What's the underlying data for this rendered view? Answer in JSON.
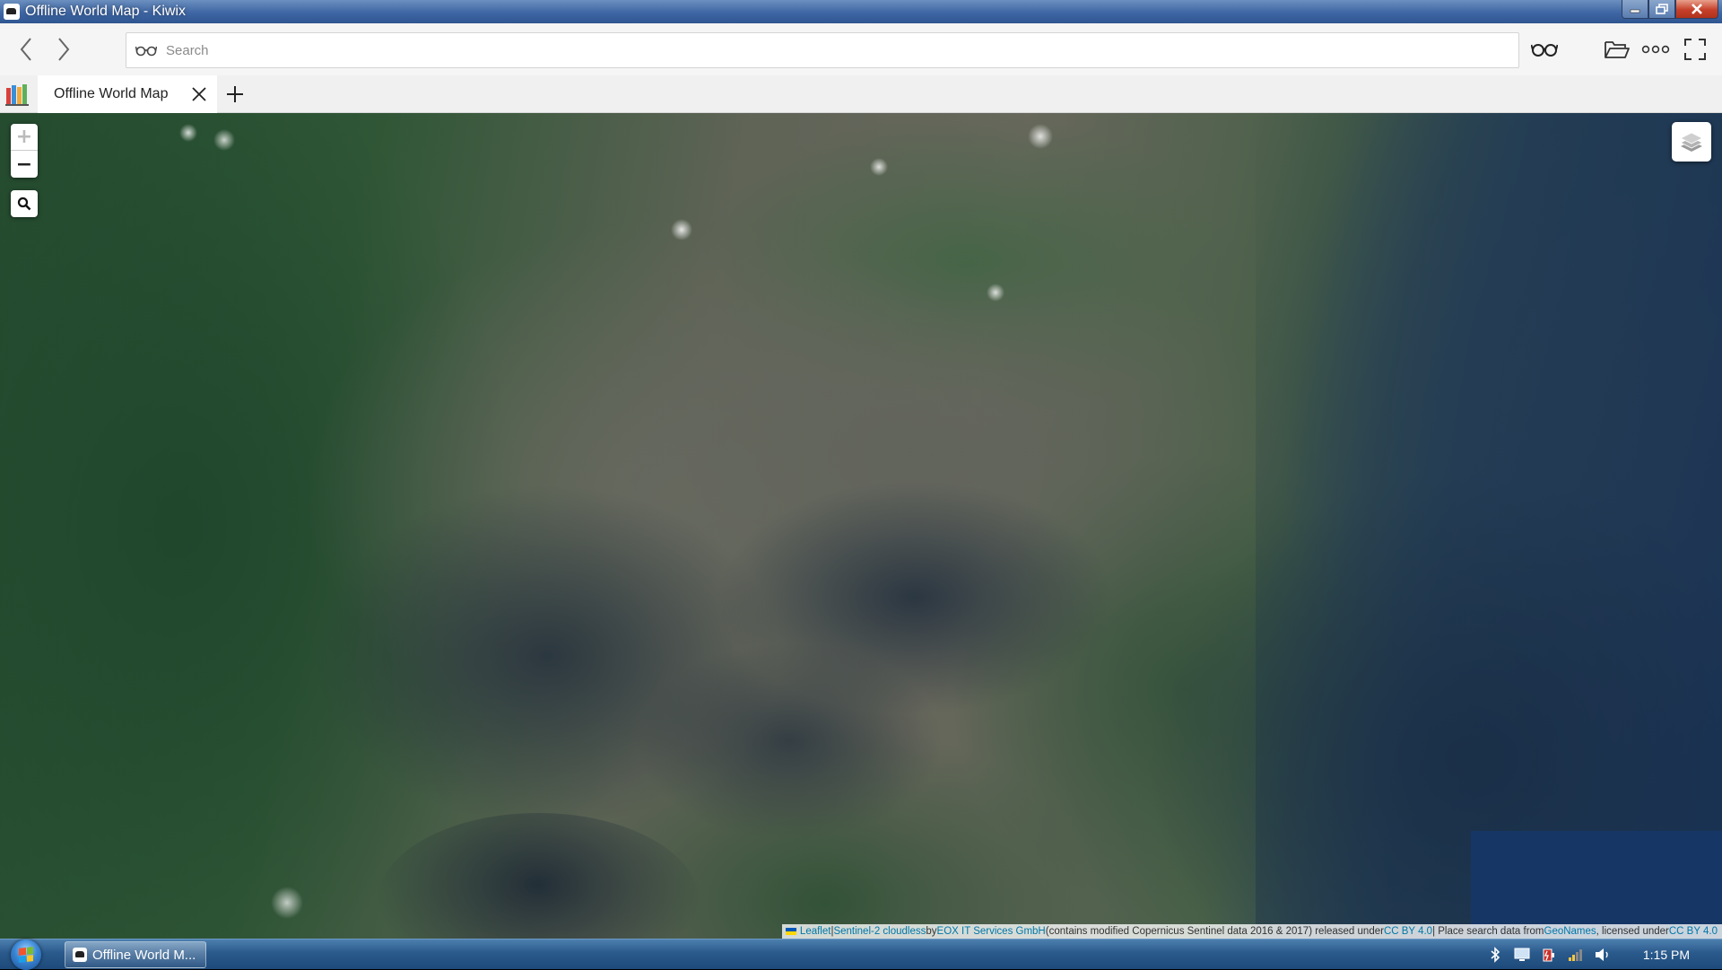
{
  "window": {
    "title": "Offline World Map - Kiwix",
    "controls": {
      "minimize": "minimize-icon",
      "maximize": "maximize-icon",
      "close": "close-icon"
    }
  },
  "toolbar": {
    "back_icon": "back-arrow-icon",
    "forward_icon": "forward-arrow-icon",
    "search_placeholder": "Search",
    "search_value": "",
    "reading_mode_icon": "glasses-icon",
    "open_file_icon": "folder-open-icon",
    "menu_icon": "more-dots-icon",
    "fullscreen_icon": "fullscreen-icon"
  },
  "tabs": {
    "library_icon": "library-books-icon",
    "items": [
      {
        "label": "Offline World Map",
        "active": true
      }
    ],
    "new_tab_icon": "plus-icon"
  },
  "map": {
    "zoom_in_label": "+",
    "zoom_out_label": "−",
    "zoom_in_disabled": true,
    "search_icon": "magnifier-icon",
    "layers_icon": "layers-icon",
    "attribution": {
      "leaflet": "Leaflet",
      "sep1": " | ",
      "sentinel": "Sentinel-2 cloudless",
      "by": " by ",
      "eox": "EOX IT Services GmbH",
      "contains": " (contains modified Copernicus Sentinel data 2016 & 2017) released under ",
      "ccby1": "CC BY 4.0",
      "sep2": " | Place search data from ",
      "geonames": "GeoNames",
      "licensed": ", licensed under ",
      "ccby2": "CC BY 4.0"
    }
  },
  "taskbar": {
    "start_icon": "windows-start-icon",
    "task_label": "Offline World M...",
    "tray_icons": [
      "bluetooth-icon",
      "display-icon",
      "power-icon",
      "network-icon",
      "volume-icon"
    ],
    "clock": "1:15 PM"
  },
  "colors": {
    "titlebar": "#3f66a4",
    "toolbar_bg": "#f5f5f5",
    "tabbar_bg": "#f0f0f0",
    "link": "#0078a8",
    "taskbar": "#2a5a8c"
  }
}
